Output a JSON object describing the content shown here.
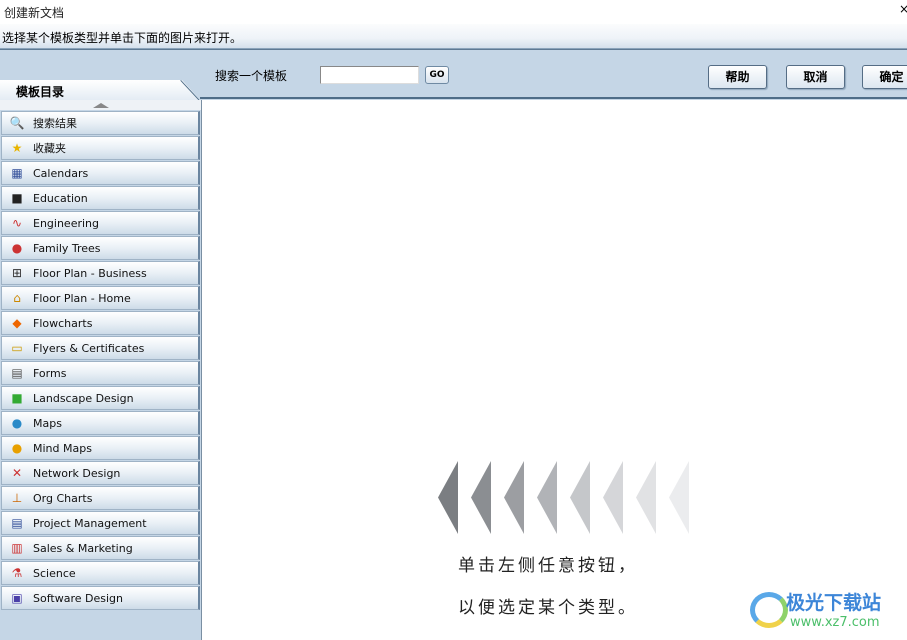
{
  "window": {
    "title": "创建新文档",
    "close": "×"
  },
  "instruction": "选择某个模板类型并单击下面的图片来打开。",
  "toolbar": {
    "tab_label": "模板目录",
    "search_label": "搜索一个模板",
    "search_value": "",
    "go_label": "GO",
    "help_label": "帮助",
    "cancel_label": "取消",
    "ok_label": "确定"
  },
  "sidebar": {
    "items": [
      {
        "label": "搜索结果",
        "icon": "search-icon"
      },
      {
        "label": "收藏夹",
        "icon": "star-icon"
      },
      {
        "label": "Calendars",
        "icon": "calendar-icon"
      },
      {
        "label": "Education",
        "icon": "blackboard-icon"
      },
      {
        "label": "Engineering",
        "icon": "circuit-icon"
      },
      {
        "label": "Family Trees",
        "icon": "people-icon"
      },
      {
        "label": "Floor Plan - Business",
        "icon": "floorplan-icon"
      },
      {
        "label": "Floor Plan - Home",
        "icon": "house-icon"
      },
      {
        "label": "Flowcharts",
        "icon": "flowchart-icon"
      },
      {
        "label": "Flyers & Certificates",
        "icon": "certificate-icon"
      },
      {
        "label": "Forms",
        "icon": "form-icon"
      },
      {
        "label": "Landscape Design",
        "icon": "landscape-icon"
      },
      {
        "label": "Maps",
        "icon": "globe-icon"
      },
      {
        "label": "Mind Maps",
        "icon": "mindmap-icon"
      },
      {
        "label": "Network Design",
        "icon": "network-icon"
      },
      {
        "label": "Org Charts",
        "icon": "orgchart-icon"
      },
      {
        "label": "Project Management",
        "icon": "project-icon"
      },
      {
        "label": "Sales & Marketing",
        "icon": "barchart-icon"
      },
      {
        "label": "Science",
        "icon": "flask-icon"
      },
      {
        "label": "Software Design",
        "icon": "floppy-icon"
      }
    ]
  },
  "main": {
    "hint_line1": "单击左侧任意按钮，",
    "hint_line2": "以便选定某个类型。",
    "chevron_colors": [
      "#7b7e82",
      "#8b8e92",
      "#9c9ea2",
      "#b1b3b7",
      "#c5c7ca",
      "#d5d6d9",
      "#e1e2e4",
      "#ebecee"
    ]
  },
  "watermark": {
    "name": "极光下载站",
    "url": "www.xz7.com"
  }
}
